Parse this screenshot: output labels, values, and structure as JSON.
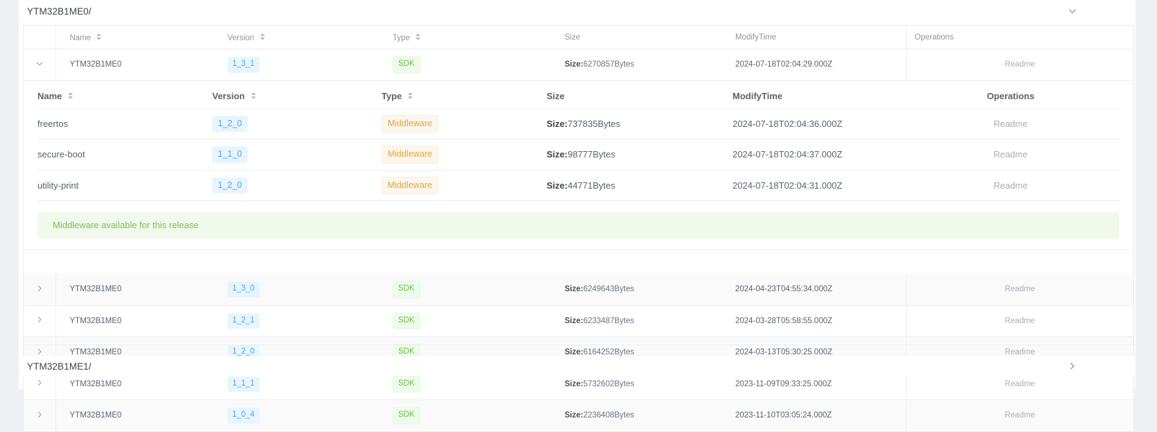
{
  "panels": [
    {
      "title": "YTM32B1ME0/",
      "expanded": true,
      "chevron": "chevron-down-icon"
    },
    {
      "title": "YTM32B1ME1/",
      "expanded": false,
      "chevron": "chevron-right-icon"
    }
  ],
  "outer_table": {
    "columns": [
      "",
      "Name",
      "Version",
      "Type",
      "Size",
      "ModifyTime",
      "Operations"
    ],
    "sortable": [
      "Name",
      "Version",
      "Type"
    ],
    "rows": [
      {
        "expand_icon": "chevron-down-icon",
        "expanded": true,
        "name": "YTM32B1ME0",
        "version": "1_3_1",
        "type": "SDK",
        "size_label": "Size:",
        "size_value": "6270857Bytes",
        "modify_time": "2024-07-18T02:04:29.000Z",
        "operation": "Readme"
      },
      {
        "expand_icon": "chevron-right-icon",
        "expanded": false,
        "name": "YTM32B1ME0",
        "version": "1_3_0",
        "type": "SDK",
        "size_label": "Size:",
        "size_value": "6249643Bytes",
        "modify_time": "2024-04-23T04:55:34.000Z",
        "operation": "Readme"
      },
      {
        "expand_icon": "chevron-right-icon",
        "expanded": false,
        "name": "YTM32B1ME0",
        "version": "1_2_1",
        "type": "SDK",
        "size_label": "Size:",
        "size_value": "6233487Bytes",
        "modify_time": "2024-03-28T05:58:55.000Z",
        "operation": "Readme"
      },
      {
        "expand_icon": "chevron-right-icon",
        "expanded": false,
        "name": "YTM32B1ME0",
        "version": "1_2_0",
        "type": "SDK",
        "size_label": "Size:",
        "size_value": "6164252Bytes",
        "modify_time": "2024-03-13T05:30:25.000Z",
        "operation": "Readme"
      },
      {
        "expand_icon": "chevron-right-icon",
        "expanded": false,
        "name": "YTM32B1ME0",
        "version": "1_1_1",
        "type": "SDK",
        "size_label": "Size:",
        "size_value": "5732602Bytes",
        "modify_time": "2023-11-09T09:33:25.000Z",
        "operation": "Readme"
      },
      {
        "expand_icon": "chevron-right-icon",
        "expanded": false,
        "name": "YTM32B1ME0",
        "version": "1_0_4",
        "type": "SDK",
        "size_label": "Size:",
        "size_value": "2236408Bytes",
        "modify_time": "2023-11-10T03:05:24.000Z",
        "operation": "Readme"
      }
    ]
  },
  "inner_table": {
    "columns": [
      "Name",
      "Version",
      "Type",
      "Size",
      "ModifyTime",
      "Operations"
    ],
    "rows": [
      {
        "name": "freertos",
        "version": "1_2_0",
        "type": "Middleware",
        "size_label": "Size:",
        "size_value": "737835Bytes",
        "modify_time": "2024-07-18T02:04:36.000Z",
        "operation": "Readme"
      },
      {
        "name": "secure-boot",
        "version": "1_1_0",
        "type": "Middleware",
        "size_label": "Size:",
        "size_value": "98777Bytes",
        "modify_time": "2024-07-18T02:04:37.000Z",
        "operation": "Readme"
      },
      {
        "name": "utility-print",
        "version": "1_2_0",
        "type": "Middleware",
        "size_label": "Size:",
        "size_value": "44771Bytes",
        "modify_time": "2024-07-18T02:04:31.000Z",
        "operation": "Readme"
      }
    ],
    "notice": "Middleware available for this release"
  },
  "colors": {
    "sdk_tag_text": "#67c23a",
    "sdk_tag_bg": "#effaef",
    "middleware_tag_text": "#e6a23c",
    "middleware_tag_bg": "#fdf6ec",
    "version_tag_text": "#4aa3f0",
    "version_tag_bg": "#e8f4fe",
    "notice_text": "#7ec050",
    "notice_bg": "#f0f9eb"
  }
}
